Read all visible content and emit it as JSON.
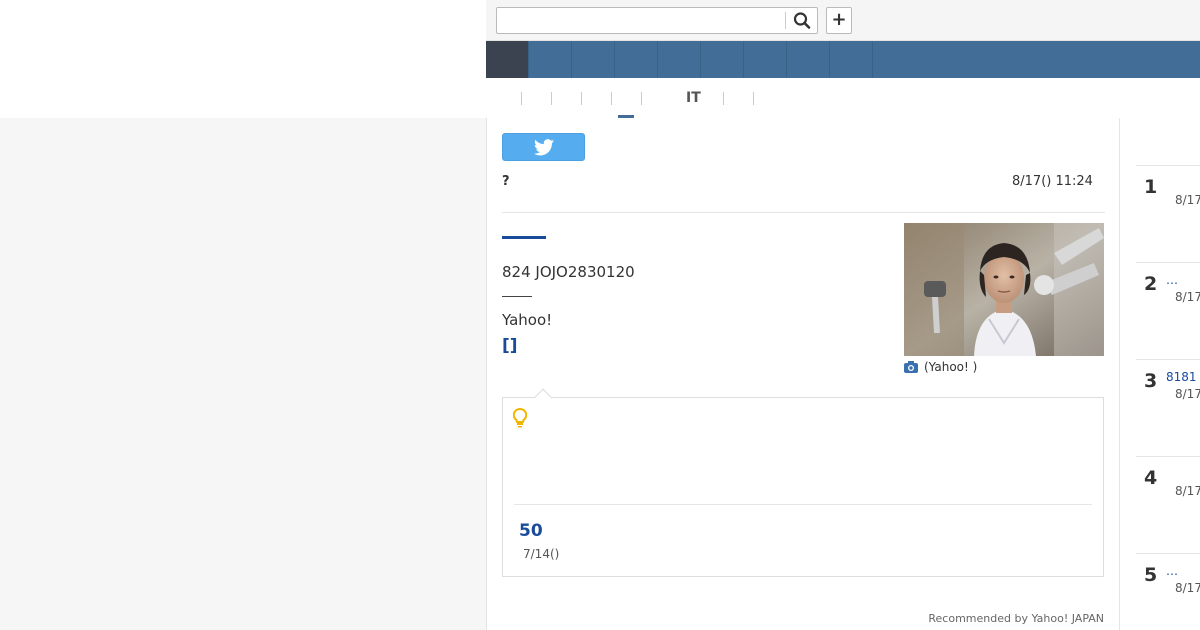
{
  "search": {
    "placeholder": "",
    "value": ""
  },
  "header": {
    "plus_label": "+"
  },
  "nav": {
    "items": [
      "",
      "",
      "",
      "",
      "",
      "",
      "",
      "",
      ""
    ]
  },
  "subnav": {
    "items": [
      "",
      "",
      "",
      "",
      "",
      "IT",
      "",
      ""
    ]
  },
  "article": {
    "tweet_label": "",
    "question": "?",
    "date": "8/17() 11:24",
    "line1": "824 JOJO2830120",
    "line2": "Yahoo!",
    "link": "[]",
    "photo_caption": "(Yahoo! )",
    "box": {
      "count": "50",
      "date": "7/14()"
    },
    "recommended": "Recommended by Yahoo! JAPAN"
  },
  "ranking": [
    {
      "rank": "1",
      "title": "",
      "date": "8/17"
    },
    {
      "rank": "2",
      "title": "…",
      "date": "8/17"
    },
    {
      "rank": "3",
      "title": "8181",
      "date": "8/17"
    },
    {
      "rank": "4",
      "title": "",
      "date": "8/17"
    },
    {
      "rank": "5",
      "title": "…",
      "date": "8/17"
    }
  ],
  "colors": {
    "nav_blue": "#426d97",
    "nav_active": "#3b4350",
    "link_blue": "#1a4b9b",
    "twitter": "#55acee"
  }
}
